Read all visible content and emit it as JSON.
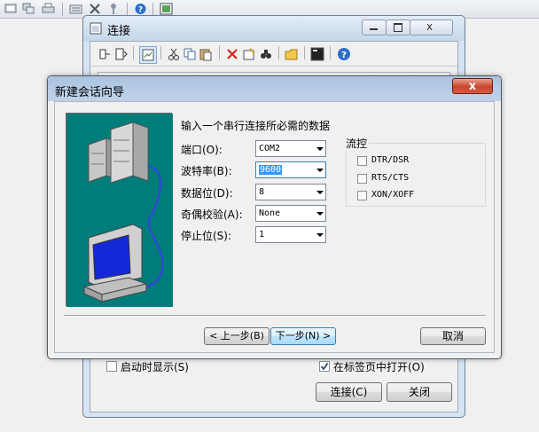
{
  "connect_window": {
    "title": "连接",
    "startup_label": "启动时显示(S)",
    "startup_checked": false,
    "open_in_tab_label": "在标签页中打开(O)",
    "open_in_tab_checked": true,
    "connect_label": "连接(C)",
    "close_label": "关闭"
  },
  "wizard": {
    "title": "新建会话向导",
    "close_glyph": "x",
    "heading": "输入一个串行连接所必需的数据",
    "fields": {
      "port": {
        "label": "端口(O):",
        "value": "COM2"
      },
      "baud": {
        "label": "波特率(B):",
        "value": "9600"
      },
      "databits": {
        "label": "数据位(D):",
        "value": "8"
      },
      "parity": {
        "label": "奇偶校验(A):",
        "value": "None"
      },
      "stopbits": {
        "label": "停止位(S):",
        "value": "1"
      }
    },
    "flow_control": {
      "title": "流控",
      "options": [
        {
          "label": "DTR/DSR",
          "checked": false
        },
        {
          "label": "RTS/CTS",
          "checked": false
        },
        {
          "label": "XON/XOFF",
          "checked": false
        }
      ]
    },
    "back_label": "< 上一步(B)",
    "next_label": "下一步(N) >",
    "cancel_label": "取消"
  },
  "colors": {
    "illustration_bg": "#007d7b",
    "selection": "#3399ff",
    "close_button": "#c8452d"
  }
}
